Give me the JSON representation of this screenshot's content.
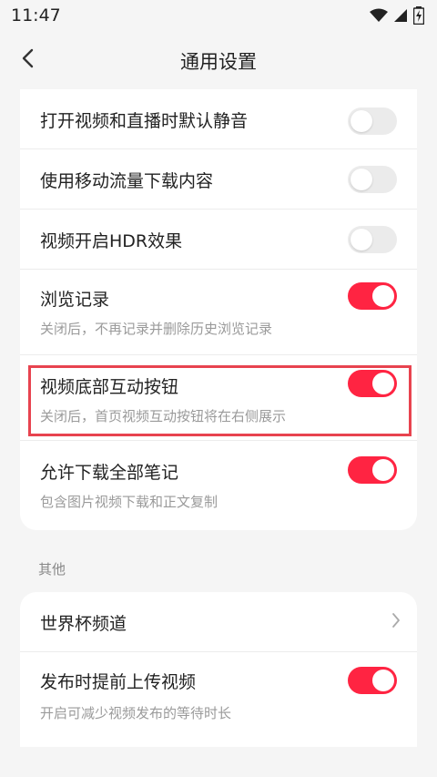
{
  "status_bar": {
    "time": "11:47",
    "icons": [
      "wifi-icon",
      "signal-icon",
      "battery-charging-icon"
    ]
  },
  "nav": {
    "title": "通用设置",
    "back_icon": "chevron-left-icon"
  },
  "settings": [
    {
      "title": "打开视频和直播时默认静音",
      "subtitle": "",
      "toggle_on": false
    },
    {
      "title": "使用移动流量下载内容",
      "subtitle": "",
      "toggle_on": false
    },
    {
      "title": "视频开启HDR效果",
      "subtitle": "",
      "toggle_on": false
    },
    {
      "title": "浏览记录",
      "subtitle": "关闭后，不再记录并删除历史浏览记录",
      "toggle_on": true
    },
    {
      "title": "视频底部互动按钮",
      "subtitle": "关闭后，首页视频互动按钮将在右侧展示",
      "toggle_on": true,
      "highlighted": true
    },
    {
      "title": "允许下载全部笔记",
      "subtitle": "包含图片视频下载和正文复制",
      "toggle_on": true
    }
  ],
  "other_section": {
    "label": "其他",
    "items": [
      {
        "title": "世界杯频道",
        "type": "link",
        "icon": "chevron-right-icon"
      },
      {
        "title": "发布时提前上传视频",
        "subtitle": "开启可减少视频发布的等待时长",
        "toggle_on": true
      }
    ]
  },
  "colors": {
    "accent": "#ff2442",
    "toggle_off": "#ebebeb",
    "highlight": "#e8434f",
    "background": "#f5f5f5"
  }
}
